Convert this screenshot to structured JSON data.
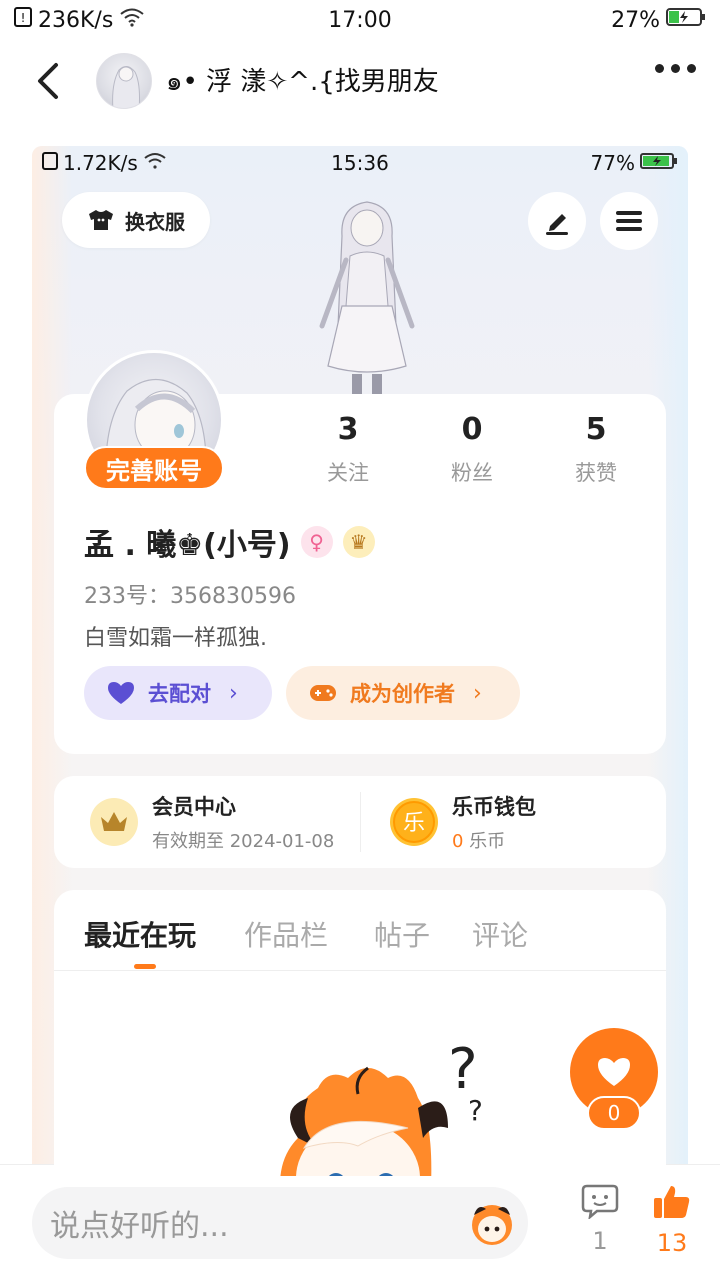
{
  "outer_status": {
    "speed": "236K/s",
    "time": "17:00",
    "battery": "27%"
  },
  "header": {
    "title": "๑• 浮  漾✧^.{找男朋友"
  },
  "screenshot": {
    "status": {
      "speed": "1.72K/s",
      "time": "15:36",
      "battery": "77%"
    },
    "dress_button": "换衣服",
    "profile": {
      "complete_label": "完善账号",
      "stats": [
        {
          "value": "3",
          "label": "关注"
        },
        {
          "value": "0",
          "label": "粉丝"
        },
        {
          "value": "5",
          "label": "获赞"
        }
      ],
      "nickname": "孟 .  曦♚(小号)",
      "badges": {
        "female": "♀",
        "crown": "♛"
      },
      "uid": "233号：356830596",
      "bio": "白雪如霜一样孤独.",
      "match_button": "去配对",
      "creator_button": "成为创作者",
      "chevron": "›"
    },
    "member": {
      "title": "会员中心",
      "subtitle": "有效期至 2024-01-08"
    },
    "wallet": {
      "title": "乐币钱包",
      "amount": "0",
      "unit": " 乐币",
      "icon_char": "乐"
    },
    "tabs": [
      "最近在玩",
      "作品栏",
      "帖子",
      "评论"
    ],
    "fav_count": "0"
  },
  "bottom": {
    "placeholder": "说点好听的...",
    "comment_count": "1",
    "like_count": "13"
  },
  "colors": {
    "accent": "#ff7a1a",
    "match": "#5b4fd3"
  }
}
